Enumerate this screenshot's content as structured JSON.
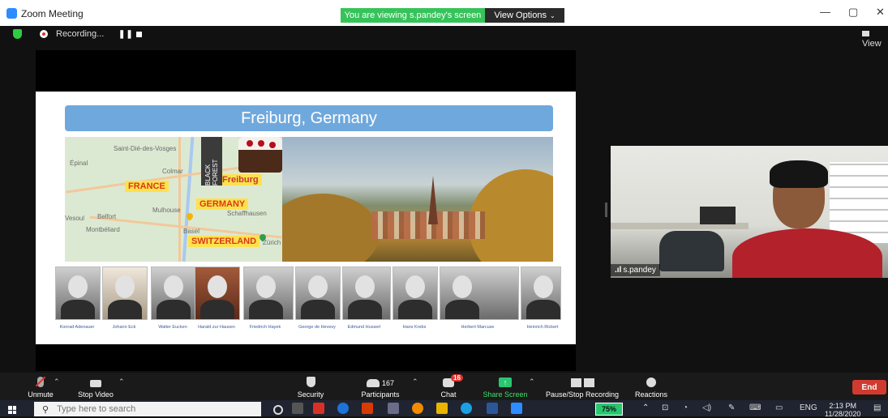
{
  "window": {
    "title": "Zoom Meeting",
    "viewing_banner": "You are viewing s.pandey's screen",
    "view_options": "View Options",
    "minimize": "—",
    "restore": "▢",
    "close": "✕"
  },
  "recording": {
    "label": "Recording...",
    "pause_glyph": "❚❚",
    "view_label": "View"
  },
  "slide": {
    "title": "Freiburg, Germany",
    "map_labels": [
      "FRANCE",
      "GERMANY",
      "SWITZERLAND",
      "Freiburg"
    ],
    "map_places": [
      "Épinal",
      "Colmar",
      "Mulhouse",
      "Belfort",
      "Vesoul",
      "Montbéliard",
      "Basel",
      "Zürich",
      "Schaffhausen",
      "Saint-Dié-des-Vosges"
    ],
    "black_forest": "BLACK FOREST",
    "people": [
      "Konrad Adenauer",
      "Johann Eck",
      "Walter Eucken",
      "Harald zur Hausen",
      "Friedrich Hayek",
      "George de Hevesy",
      "Edmund Husserl",
      "Hans Krebs",
      "Herbert Marcuse",
      "Heinrich Rickert"
    ]
  },
  "video": {
    "participant_name": "s.pandey"
  },
  "toolbar": {
    "unmute": "Unmute",
    "stop_video": "Stop Video",
    "security": "Security",
    "participants": "Participants",
    "participants_count": "167",
    "chat": "Chat",
    "chat_badge": "16",
    "share_screen": "Share Screen",
    "pause_stop_recording": "Pause/Stop Recording",
    "reactions": "Reactions",
    "end": "End"
  },
  "taskbar": {
    "search_placeholder": "Type here to search",
    "battery": "75%",
    "language": "ENG",
    "time": "2:13 PM",
    "date": "11/28/2020"
  },
  "colors": {
    "zoom_blue": "#2d8cff",
    "viewing_green": "#36c35a",
    "end_red": "#d13b2f",
    "share_green": "#28c76f"
  }
}
